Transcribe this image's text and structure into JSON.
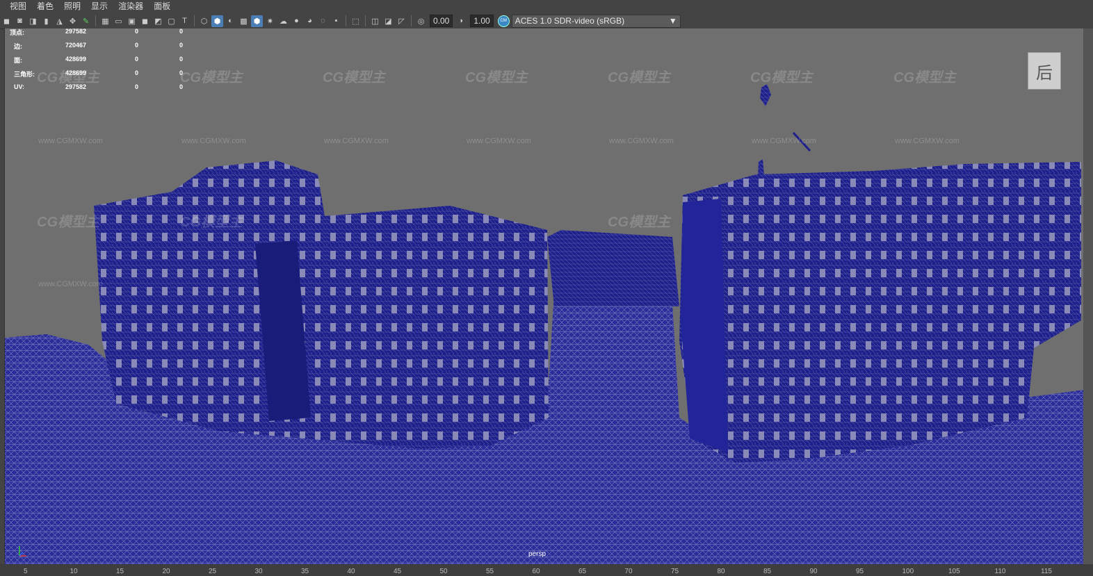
{
  "menu": [
    "视图",
    "着色",
    "照明",
    "显示",
    "渲染器",
    "面板"
  ],
  "toolbar": {
    "exposure": "0.00",
    "gamma": "1.00",
    "cs_icon": "CM",
    "color_space": "ACES 1.0 SDR-video (sRGB)"
  },
  "hud": [
    {
      "label": "顶点:",
      "total": "297582",
      "sel": "0",
      "comp": "0"
    },
    {
      "label": "边:",
      "total": "720467",
      "sel": "0",
      "comp": "0"
    },
    {
      "label": "面:",
      "total": "428699",
      "sel": "0",
      "comp": "0"
    },
    {
      "label": "三角形:",
      "total": "428699",
      "sel": "0",
      "comp": "0"
    },
    {
      "label": "UV:",
      "total": "297582",
      "sel": "0",
      "comp": "0"
    }
  ],
  "camera": "persp",
  "viewcube_face": "后",
  "watermark": {
    "logo": "CG模型主",
    "url": "www.CGMXW.com"
  },
  "ruler": [
    "5",
    "10",
    "15",
    "20",
    "25",
    "30",
    "35",
    "40",
    "45",
    "50",
    "55",
    "60",
    "65",
    "70",
    "75",
    "80",
    "85",
    "90",
    "95",
    "100",
    "105",
    "110",
    "115"
  ],
  "colors": {
    "wire": "#1a1c8a",
    "viewport_bg": "#6f6f6f",
    "accent": "#4a7eb5"
  }
}
